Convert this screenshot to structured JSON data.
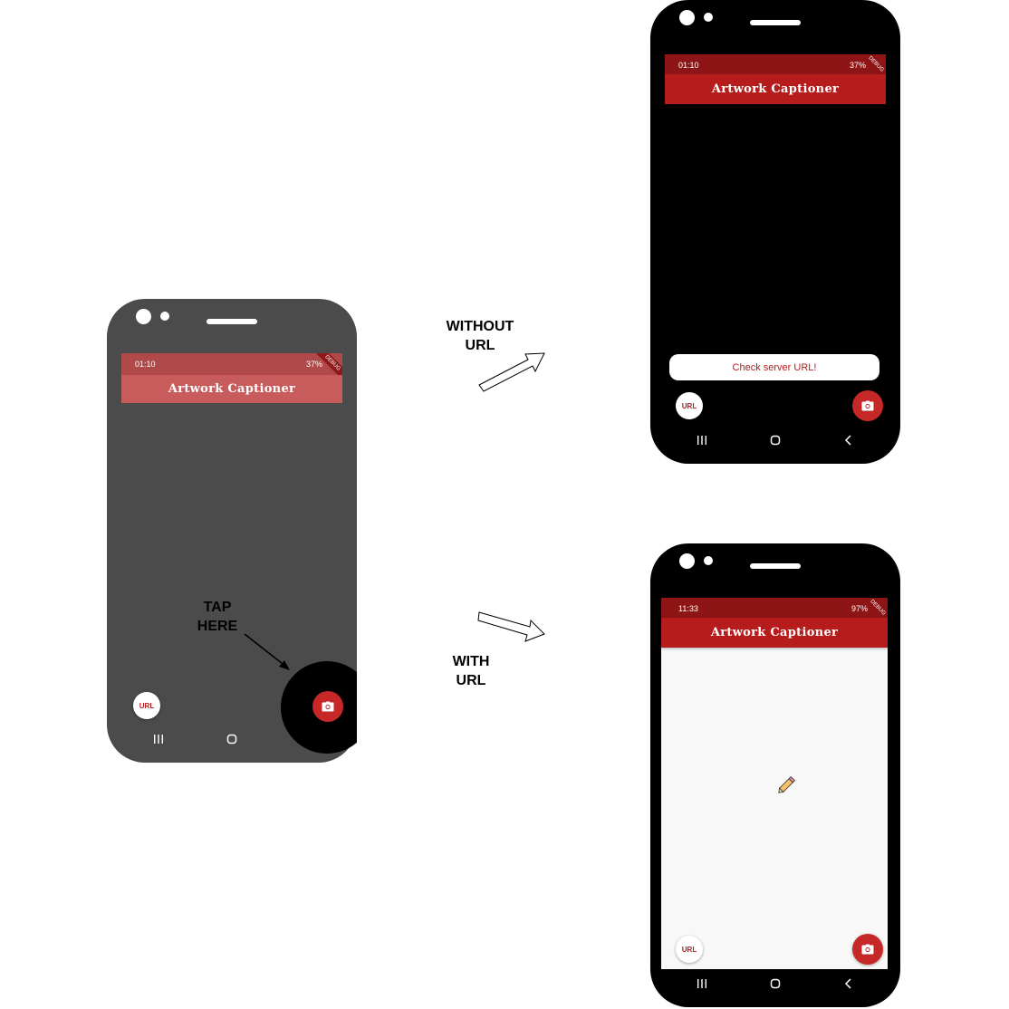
{
  "app": {
    "title": "Artwork Captioner",
    "url_button_label": "URL",
    "debug_label": "DEBUG"
  },
  "left_phone": {
    "status_time": "01:10",
    "status_right": "37%"
  },
  "top_phone": {
    "status_time": "01:10",
    "status_right": "37%",
    "snackbar_message": "Check server URL!"
  },
  "bottom_phone": {
    "status_time": "11:33",
    "status_right": "97%"
  },
  "annotations": {
    "tap_here": "TAP\nHERE",
    "without_url": "WITHOUT\nURL",
    "with_url": "WITH\nURL"
  },
  "colors": {
    "app_bar_red": "#b71c1c",
    "status_bar_dark_red": "#8e1515",
    "faded_app_bar": "#c85c5c",
    "camera_button_red": "#c62828",
    "dimmed_overlay": "#4b4b4b",
    "content_background": "#f8f8f8"
  },
  "icons": [
    "camera-icon",
    "recent-apps-icon",
    "home-icon",
    "back-icon",
    "pencil-icon",
    "arrow-icon"
  ]
}
